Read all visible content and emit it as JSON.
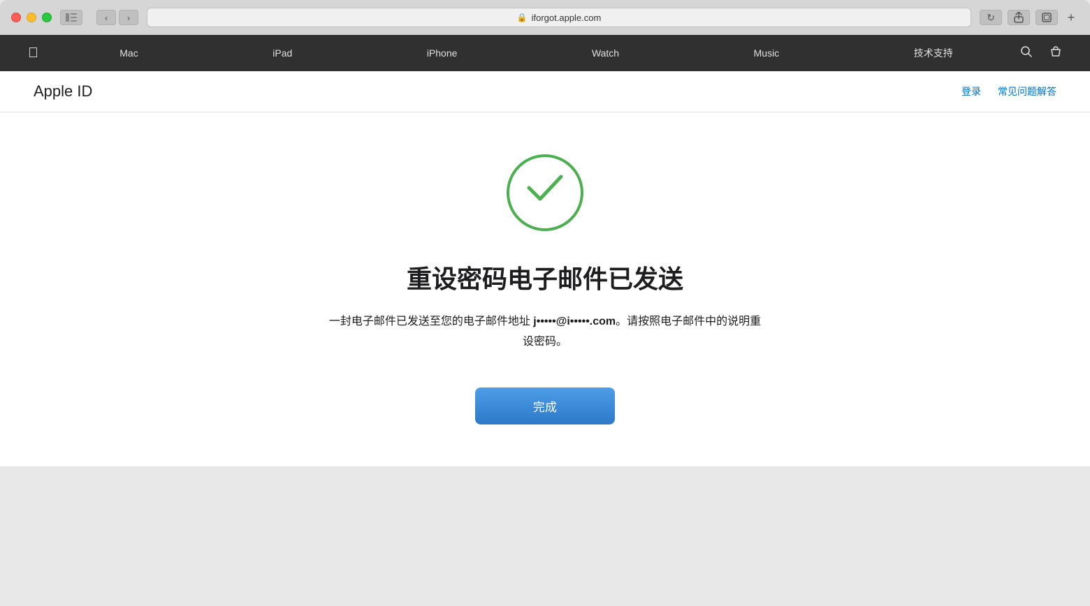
{
  "browser": {
    "url": "iforgot.apple.com",
    "lock_symbol": "🔒",
    "reload_symbol": "↻"
  },
  "nav": {
    "logo_symbol": "",
    "items": [
      {
        "id": "mac",
        "label": "Mac"
      },
      {
        "id": "ipad",
        "label": "iPad"
      },
      {
        "id": "iphone",
        "label": "iPhone"
      },
      {
        "id": "watch",
        "label": "Watch"
      },
      {
        "id": "music",
        "label": "Music"
      },
      {
        "id": "support",
        "label": "技术支持"
      }
    ],
    "search_symbol": "🔍",
    "bag_symbol": "🛍"
  },
  "page_header": {
    "title": "Apple ID",
    "links": [
      {
        "id": "login",
        "label": "登录"
      },
      {
        "id": "faq",
        "label": "常见问题解答"
      }
    ]
  },
  "main": {
    "success_title": "重设密码电子邮件已发送",
    "description_before": "一封电子邮件已发送至您的电子邮件地址 ",
    "email": "j•••••@i•••••.com",
    "description_after": "。请按照电子邮件中的说明重设密码。",
    "done_button_label": "完成"
  }
}
